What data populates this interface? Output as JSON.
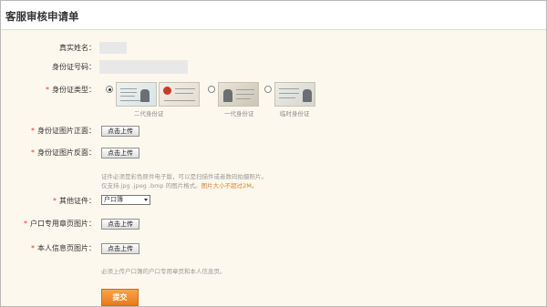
{
  "header": {
    "title": "客服审核申请单"
  },
  "form": {
    "real_name": {
      "label": "真实姓名：",
      "value": ""
    },
    "id_number": {
      "label": "身份证号码：",
      "value": ""
    },
    "id_type": {
      "label": "身份证类型：",
      "options": [
        {
          "caption": "二代身份证",
          "selected": true
        },
        {
          "caption": "一代身份证",
          "selected": false
        },
        {
          "caption": "临时身份证",
          "selected": false
        }
      ]
    },
    "id_front": {
      "label": "身份证图片正面：",
      "button": "点击上传"
    },
    "id_back": {
      "label": "身份证图片反面：",
      "button": "点击上传"
    },
    "id_hint": {
      "line1": "证件必须是彩色原件电子版，可以是扫描件或者数码拍摄照片。",
      "line2": "仅支持.jpg .jpeg .bmp 的图片格式。",
      "warn": "图片大小不超过2M。"
    },
    "other_id": {
      "label": "其他证件：",
      "selected": "户口簿"
    },
    "household_page": {
      "label": "户口专用章页图片：",
      "button": "点击上传"
    },
    "personal_page": {
      "label": "本人信息页图片：",
      "button": "点击上传"
    },
    "household_hint": "必须上传户口簿的户口专用章页和本人信息页。",
    "submit_label": "提交"
  },
  "colors": {
    "required_star": "#e03a3a",
    "warning_text": "#e8812b",
    "submit_button": "#ef8a28",
    "page_background": "#fdf8ee"
  }
}
